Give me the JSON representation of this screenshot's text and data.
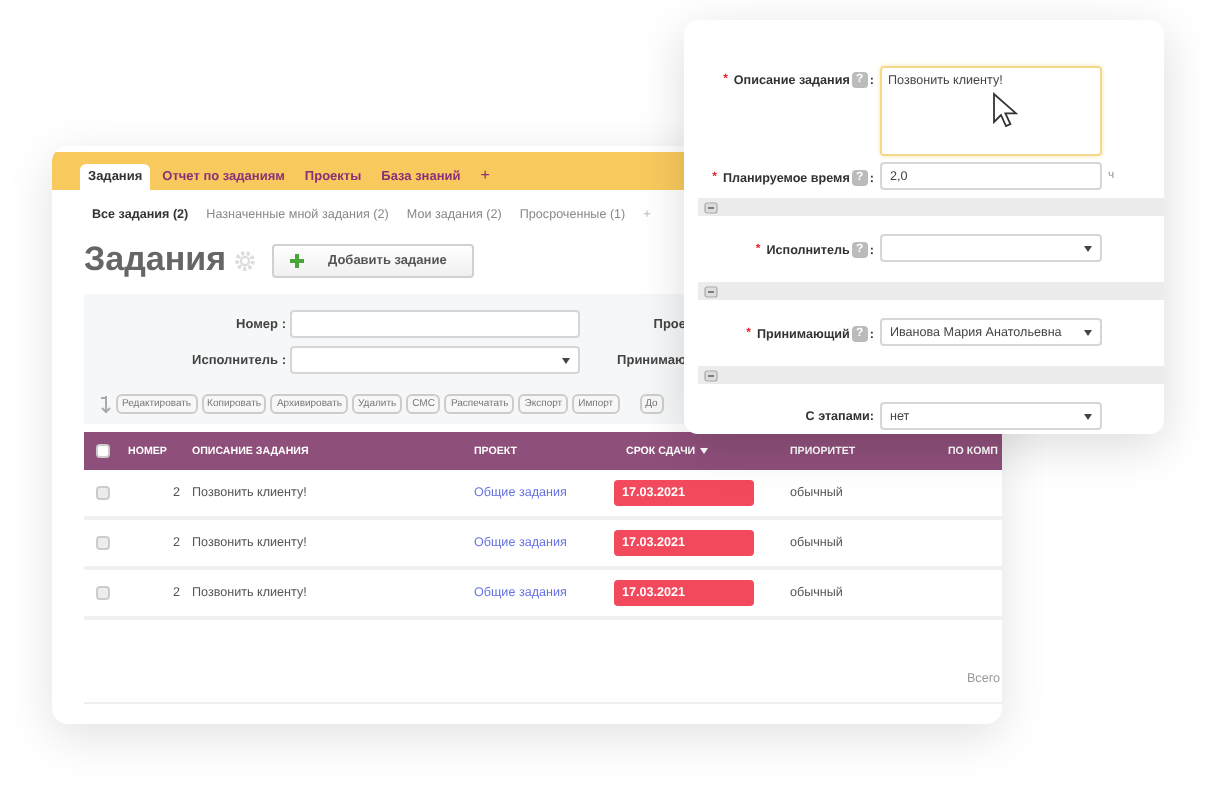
{
  "main_window": {
    "tabs": [
      {
        "label": "Задания",
        "selected": true
      },
      {
        "label": "Отчет по заданиям",
        "selected": false
      },
      {
        "label": "Проекты",
        "selected": false
      },
      {
        "label": "База знаний",
        "selected": false
      }
    ],
    "add_tab": "+",
    "subtabs": [
      {
        "label": "Все задания (2)",
        "selected": true
      },
      {
        "label": "Назначенные мной задания (2)",
        "selected": false
      },
      {
        "label": "Мои задания (2)",
        "selected": false
      },
      {
        "label": "Просроченные (1)",
        "selected": false
      }
    ],
    "add_subtab": "+",
    "title": "Задания",
    "add_button": "Добавить задание",
    "filters": [
      {
        "label": "Номер :",
        "kind": "text",
        "side_label": "Прое"
      },
      {
        "label": "Исполнитель :",
        "kind": "select",
        "side_label": "Принимаю"
      }
    ],
    "actions": [
      "Редактировать",
      "Копировать",
      "Архивировать",
      "Удалить",
      "СМС",
      "Распечатать",
      "Экспорт",
      "Импорт",
      "До"
    ],
    "table": {
      "all_checked": false,
      "columns": [
        {
          "label": "НОМЕР",
          "sorted": false
        },
        {
          "label": "ОПИСАНИЕ ЗАДАНИЯ",
          "sorted": false
        },
        {
          "label": "ПРОЕКТ",
          "sorted": false
        },
        {
          "label": "СРОК СДАЧИ",
          "sorted": true
        },
        {
          "label": "ПРИОРИТЕТ",
          "sorted": false
        },
        {
          "label": "ПО КОМП",
          "sorted": false
        }
      ],
      "rows": [
        {
          "checked": false,
          "number": "2",
          "description": "Позвонить клиенту!",
          "project": "Общие задания",
          "due": "17.03.2021",
          "overdue": true,
          "priority": "обычный"
        },
        {
          "checked": false,
          "number": "2",
          "description": "Позвонить клиенту!",
          "project": "Общие задания",
          "due": "17.03.2021",
          "overdue": true,
          "priority": "обычный"
        },
        {
          "checked": false,
          "number": "2",
          "description": "Позвонить клиенту!",
          "project": "Общие задания",
          "due": "17.03.2021",
          "overdue": true,
          "priority": "обычный"
        }
      ]
    },
    "footer": "Всего"
  },
  "task_form": {
    "fields": [
      {
        "kind": "textarea",
        "required_mark": "*",
        "label": "Описание задания",
        "help": "?",
        "colon": ":",
        "value": "Позвонить клиенту!",
        "focused": true
      },
      {
        "kind": "text",
        "required_mark": "*",
        "label": "Планируемое время",
        "help": "?",
        "colon": ":",
        "value": "2,0",
        "unit": "ч",
        "focused": false
      },
      {
        "kind": "section",
        "expanded": true
      },
      {
        "kind": "select",
        "required_mark": "*",
        "label": "Исполнитель",
        "help": "?",
        "colon": ":",
        "focused": false
      },
      {
        "kind": "section",
        "expanded": true
      },
      {
        "kind": "select",
        "required_mark": "*",
        "label": "Принимающий",
        "help": "?",
        "colon": ":",
        "value": "Иванова Мария Анатольевна",
        "focused": false
      },
      {
        "kind": "section",
        "expanded": true
      },
      {
        "kind": "select",
        "label": "С этапами:",
        "value": "нет",
        "focused": false
      }
    ]
  }
}
